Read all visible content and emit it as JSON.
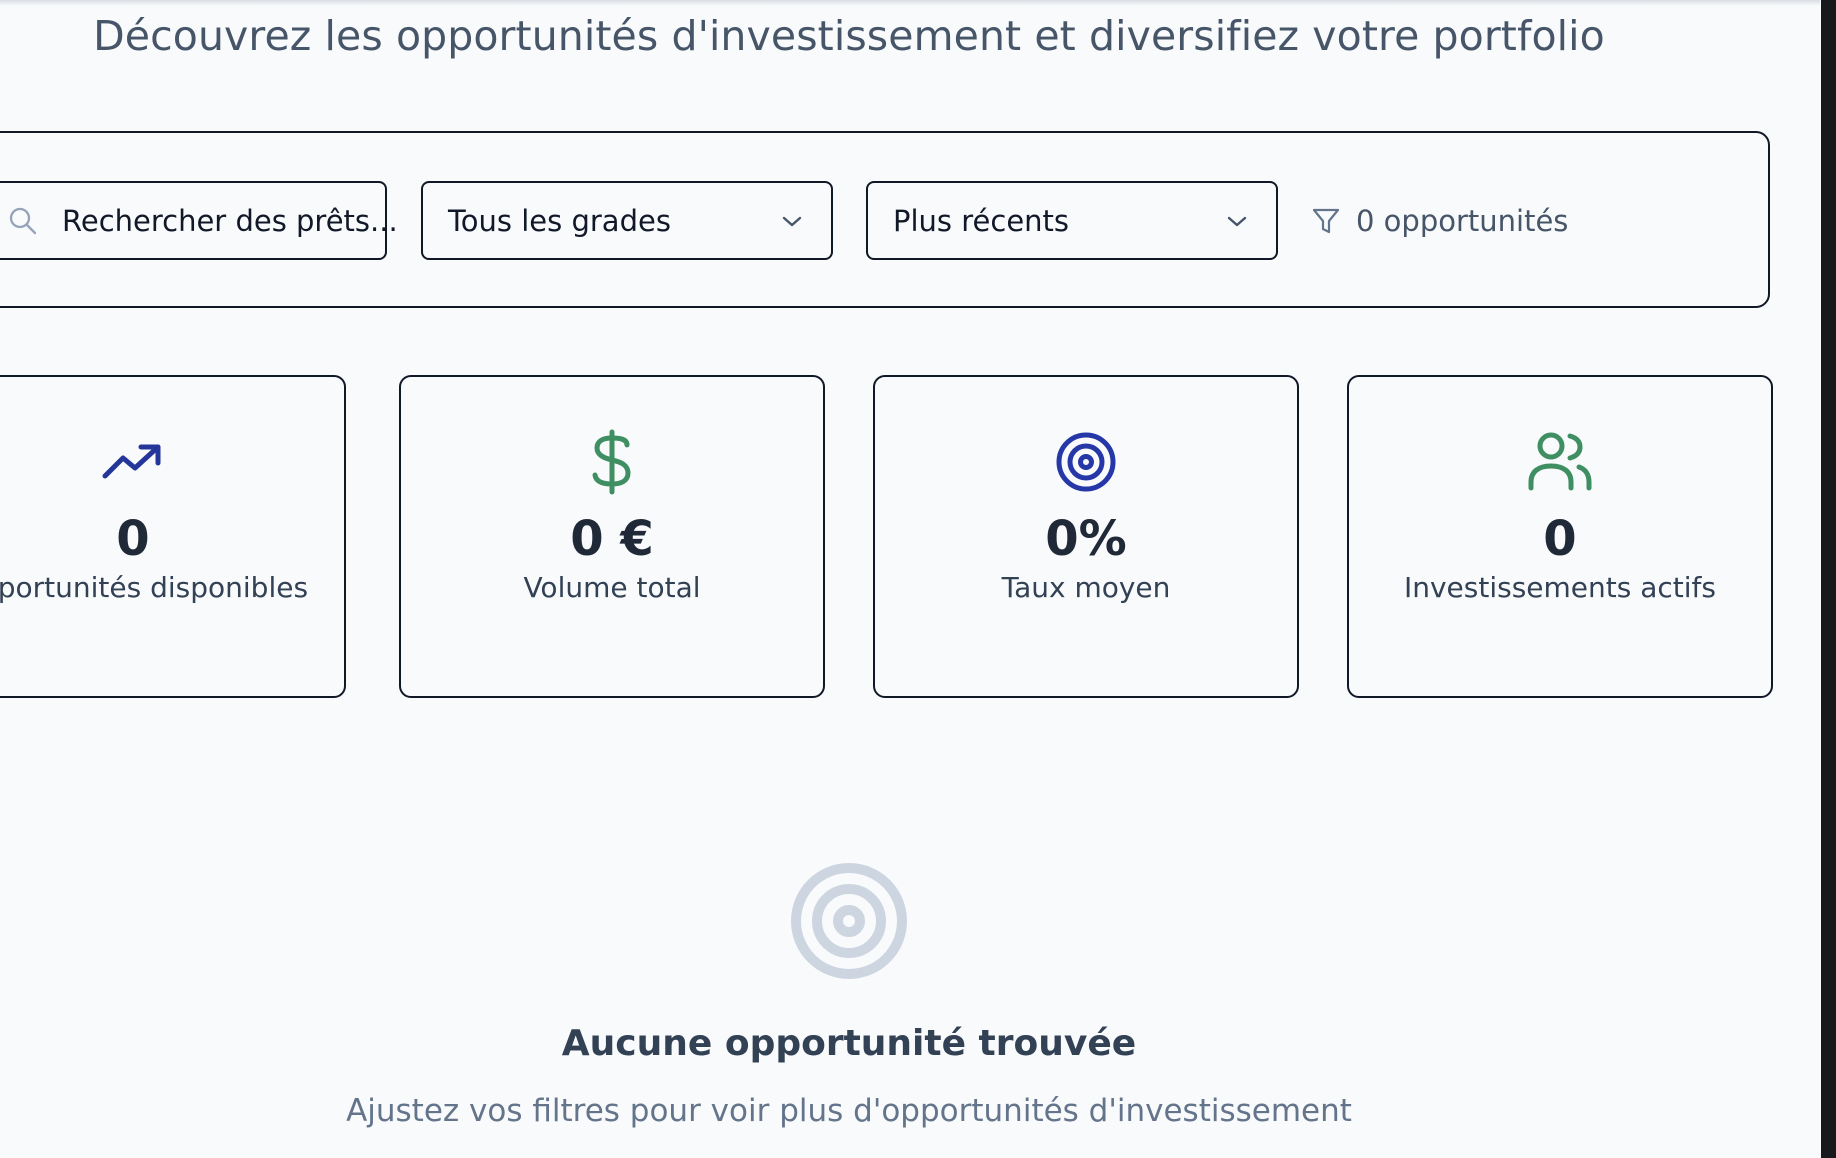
{
  "header": {
    "subtitle": "Découvrez les opportunités d'investissement et diversifiez votre portfolio"
  },
  "filters": {
    "search_value": "Rechercher des prêts...",
    "search_icon": "search-icon",
    "grade_select": "Tous les grades",
    "sort_select": "Plus récents",
    "result_count": "0 opportunités",
    "filter_icon": "filter-icon"
  },
  "stats": [
    {
      "icon": "trending-up-icon",
      "icon_color": "#25369a",
      "value": "0",
      "label": "Opportunités disponibles"
    },
    {
      "icon": "dollar-icon",
      "icon_color": "#3f8f62",
      "value": "0 €",
      "label": "Volume total"
    },
    {
      "icon": "target-icon",
      "icon_color": "#2638a8",
      "value": "0%",
      "label": "Taux moyen"
    },
    {
      "icon": "users-icon",
      "icon_color": "#3f8f62",
      "value": "0",
      "label": "Investissements actifs"
    }
  ],
  "empty_state": {
    "icon": "target-icon",
    "icon_color": "#cdd5e0",
    "title": "Aucune opportunité trouvée",
    "hint": "Ajustez vos filtres pour voir plus d'opportunités d'investissement"
  }
}
